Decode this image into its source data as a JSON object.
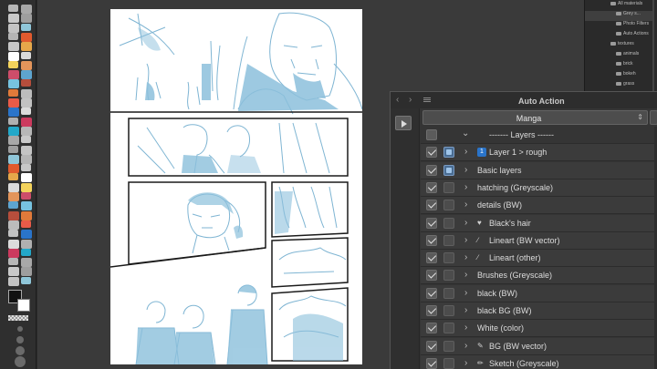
{
  "toolbar": {
    "tool_colors": [
      "#b7b7b7",
      "#a8a8a8",
      "#c9c9c9",
      "#9e9e9e",
      "#c4c4c4",
      "#8fc6d9",
      "#b5b5b5",
      "#e05a2e",
      "#c7c7c7",
      "#e6a74a",
      "#ffffff",
      "#dadada",
      "#f3d35c",
      "#e3955b",
      "#cd4d6a",
      "#5ea4cf",
      "#77c3e0",
      "#b64e3c",
      "#e07a3a",
      "#bcbcbc",
      "#e95b48",
      "#c2c2c2",
      "#2a74c9",
      "#dbdbdb",
      "#b0b0b0",
      "#cc3a5e",
      "#23a8c9"
    ],
    "foreground_color": "#111111",
    "background_color": "#ffffff"
  },
  "materials": {
    "items": [
      {
        "label": "All materials",
        "selected": false
      },
      {
        "label": "Grey s...",
        "selected": true
      },
      {
        "label": "Photo Filters",
        "selected": false
      },
      {
        "label": "Auto Actions",
        "selected": false
      },
      {
        "label": "textures",
        "selected": false
      },
      {
        "label": "animals",
        "selected": false
      },
      {
        "label": "brick",
        "selected": false
      },
      {
        "label": "bokeh",
        "selected": false
      },
      {
        "label": "grass",
        "selected": false
      }
    ]
  },
  "auto_action": {
    "title": "Auto Action",
    "nav_back": "‹",
    "nav_forward": "›",
    "set_name": "Manga",
    "header_row": "------- Layers ------",
    "rows": [
      {
        "label": "Layer 1 > rough",
        "badge": "1",
        "icon": "",
        "icon_name": "",
        "sub_checked": true
      },
      {
        "label": "Basic layers",
        "badge": "",
        "icon": "",
        "icon_name": "",
        "sub_checked": true
      },
      {
        "label": "hatching (Greyscale)",
        "badge": "",
        "icon": "",
        "icon_name": "",
        "sub_checked": false
      },
      {
        "label": "details (BW)",
        "badge": "",
        "icon": "",
        "icon_name": "",
        "sub_checked": false
      },
      {
        "label": "Black's hair",
        "badge": "",
        "icon": "♥",
        "icon_name": "heart-icon",
        "sub_checked": false
      },
      {
        "label": "Lineart (BW vector)",
        "badge": "",
        "icon": "∕",
        "icon_name": "pen-icon",
        "sub_checked": false
      },
      {
        "label": "Lineart (other)",
        "badge": "",
        "icon": "∕",
        "icon_name": "pen-icon",
        "sub_checked": false
      },
      {
        "label": "Brushes (Greyscale)",
        "badge": "",
        "icon": "",
        "icon_name": "",
        "sub_checked": false
      },
      {
        "label": "black (BW)",
        "badge": "",
        "icon": "",
        "icon_name": "",
        "sub_checked": false
      },
      {
        "label": "black BG (BW)",
        "badge": "",
        "icon": "",
        "icon_name": "",
        "sub_checked": false
      },
      {
        "label": "White (color)",
        "badge": "",
        "icon": "",
        "icon_name": "",
        "sub_checked": false
      },
      {
        "label": "BG (BW vector)",
        "badge": "",
        "icon": "✎",
        "icon_name": "pen-nib-icon",
        "sub_checked": false
      },
      {
        "label": "Sketch (Greyscale)",
        "badge": "",
        "icon": "✏",
        "icon_name": "pencil-icon",
        "sub_checked": false
      }
    ]
  },
  "colors": {
    "sketch_blue": "#7fb5d3",
    "panel_bg": "#353535",
    "checkbox_accent": "#4a6d93"
  }
}
